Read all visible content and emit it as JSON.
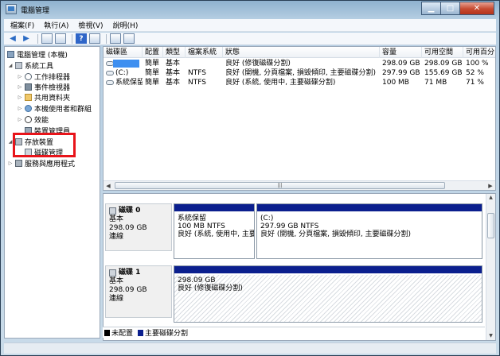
{
  "window": {
    "title": "電腦管理"
  },
  "menu": [
    "檔案(F)",
    "執行(A)",
    "檢視(V)",
    "說明(H)"
  ],
  "tree": [
    {
      "label": "電腦管理 (本機)",
      "icon": "computer-icon",
      "level": 0,
      "expander": ""
    },
    {
      "label": "系統工具",
      "icon": "tools-icon",
      "level": 1,
      "expander": "◢"
    },
    {
      "label": "工作排程器",
      "icon": "clock-icon",
      "level": 2,
      "expander": "▷"
    },
    {
      "label": "事件檢視器",
      "icon": "event-viewer-icon",
      "level": 2,
      "expander": "▷"
    },
    {
      "label": "共用資料夾",
      "icon": "shared-folder-icon",
      "level": 2,
      "expander": "▷"
    },
    {
      "label": "本機使用者和群組",
      "icon": "users-icon",
      "level": 2,
      "expander": "▷"
    },
    {
      "label": "效能",
      "icon": "performance-icon",
      "level": 2,
      "expander": "▷"
    },
    {
      "label": "裝置管理員",
      "icon": "device-manager-icon",
      "level": 2,
      "expander": ""
    },
    {
      "label": "存放裝置",
      "icon": "storage-icon",
      "level": 1,
      "expander": "◢"
    },
    {
      "label": "磁碟管理",
      "icon": "disk-management-icon",
      "level": 2,
      "expander": ""
    },
    {
      "label": "服務與應用程式",
      "icon": "services-icon",
      "level": 1,
      "expander": "▷"
    }
  ],
  "volumes": {
    "columns": [
      "磁碟區",
      "配置",
      "類型",
      "檔案系統",
      "狀態",
      "容量",
      "可用空間",
      "可用百分"
    ],
    "rows": [
      [
        "",
        "簡單",
        "基本",
        "",
        "良好 (修復磁碟分割)",
        "298.09 GB",
        "298.09 GB",
        "100 %"
      ],
      [
        "(C:)",
        "簡單",
        "基本",
        "NTFS",
        "良好 (開機, 分頁檔案, 損毀傾印, 主要磁碟分割)",
        "297.99 GB",
        "155.69 GB",
        "52 %"
      ],
      [
        "系統保留",
        "簡單",
        "基本",
        "NTFS",
        "良好 (系統, 使用中, 主要磁碟分割)",
        "100 MB",
        "71 MB",
        "71 %"
      ]
    ]
  },
  "disks": [
    {
      "name": "磁碟 0",
      "type": "基本",
      "size": "298.09 GB",
      "status": "連線",
      "partitions": [
        {
          "name": "系統保留",
          "size": "100 MB NTFS",
          "status": "良好 (系統, 使用中, 主要"
        },
        {
          "name": "(C:)",
          "size": "297.99 GB NTFS",
          "status": "良好 (開機, 分頁檔案, 損毀傾印, 主要磁碟分割)"
        }
      ]
    },
    {
      "name": "磁碟 1",
      "type": "基本",
      "size": "298.09 GB",
      "status": "連線",
      "partitions": [
        {
          "name": "",
          "size": "298.09 GB",
          "status": "良好 (修復磁碟分割)"
        }
      ]
    }
  ],
  "legend": {
    "unallocated": "未配置",
    "primary": "主要磁碟分割"
  },
  "colors": {
    "primary_partition": "#0b1f8e",
    "selection": "#3e8ff0",
    "highlight_box": "#e8141a"
  }
}
